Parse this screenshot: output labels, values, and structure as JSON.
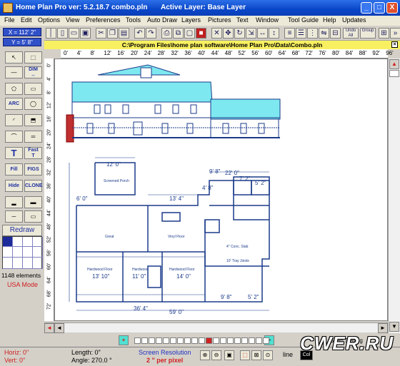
{
  "window": {
    "title": "Home Plan Pro ver: 5.2.18.7    combo.pln",
    "active_layer": "Active Layer: Base Layer",
    "minimize": "_",
    "maximize": "□",
    "close": "X"
  },
  "menu": [
    "File",
    "Edit",
    "Options",
    "View",
    "Preferences",
    "Tools",
    "Auto Draw",
    "Layers",
    "Pictures",
    "Text",
    "Window",
    "Tool Guide",
    "Help",
    "Updates"
  ],
  "coords": {
    "x": "X = 112' 2\"",
    "y": "Y = 5' 8\""
  },
  "toolbar": {
    "buttons": [
      "new-icon",
      "open-icon",
      "save-icon",
      "cut-icon",
      "copy-icon",
      "paste-icon",
      "undo-icon",
      "redo-icon",
      "print-icon",
      "duplicate-icon",
      "delete-icon",
      "move-icon",
      "rotate-icon",
      "flip-h-icon",
      "flip-v-icon",
      "align-icon",
      "distribute-icon",
      "undo-all-icon",
      "group-icon"
    ],
    "undo_label": "Undo All",
    "group_label": "Group"
  },
  "file_path": "C:\\Program Files\\home plan software\\Home Plan Pro\\Data\\Combo.pln",
  "file_close": "×",
  "ruler": {
    "h": [
      "0'",
      "4'",
      "8'",
      "12'",
      "16'",
      "20'",
      "24'",
      "28'",
      "32'",
      "36'",
      "40'",
      "44'",
      "48'",
      "52'",
      "56'",
      "60'",
      "64'",
      "68'",
      "72'",
      "76'",
      "80'",
      "84'",
      "88'",
      "92'",
      "96'"
    ],
    "v": [
      "0'",
      "4'",
      "8'",
      "12'",
      "16'",
      "20'",
      "24'",
      "28'",
      "32'",
      "36'",
      "40'",
      "44'",
      "48'",
      "52'",
      "56'",
      "60'",
      "64'",
      "68'",
      "72'"
    ]
  },
  "tools": {
    "dim_label": "DIM",
    "arc_label": "ARC",
    "text_label": "T",
    "fast_text_label": "Fast",
    "fill_label": "Fill",
    "figs_label": "FIGS",
    "hide_label": "Hide",
    "clone_label": "CLONE"
  },
  "redraw": "Redraw",
  "element_count": "1148 elements",
  "mode": "USA Mode",
  "plan_labels": {
    "overall_width": "59' 0\"",
    "dim_22": "22' 0\"",
    "dim_12": "12' 0\"",
    "dim_13_4": "13' 4\"",
    "dim_13_10": "13' 10\"",
    "dim_11": "11' 0\"",
    "dim_14": "14' 0\"",
    "dim_36_4": "36' 4\"",
    "dim_9_8": "9' 8\"",
    "dim_7_2": "7' 2\"",
    "dim_5_2": "5' 2\"",
    "dim_6_0": "6' 0\"",
    "dim_4_8": "4' 8\"",
    "room_porch": "Screened Porch",
    "room_great": "Great",
    "room_vinyl": "Vinyl Floor",
    "room_hard1": "Hardwood Floor",
    "room_hard2": "Hardwood",
    "room_hard3": "Hardwood Floor",
    "room_slab": "4\" Conc. Slab",
    "room_tray": "10' Tray Joists"
  },
  "layer_controls": {
    "add": "+",
    "remove": "−"
  },
  "snap": "Snap Setting",
  "status": {
    "horiz": "Horiz: 0\"",
    "vert": "Vert: 0\"",
    "length": "Length:  0\"",
    "angle": "Angle:  270.0 °",
    "screen_res": "Screen Resolution",
    "per_pixel": "2 \" per pixel",
    "line_label": "line",
    "color_label": "Col"
  },
  "watermark": "CWER.RU"
}
